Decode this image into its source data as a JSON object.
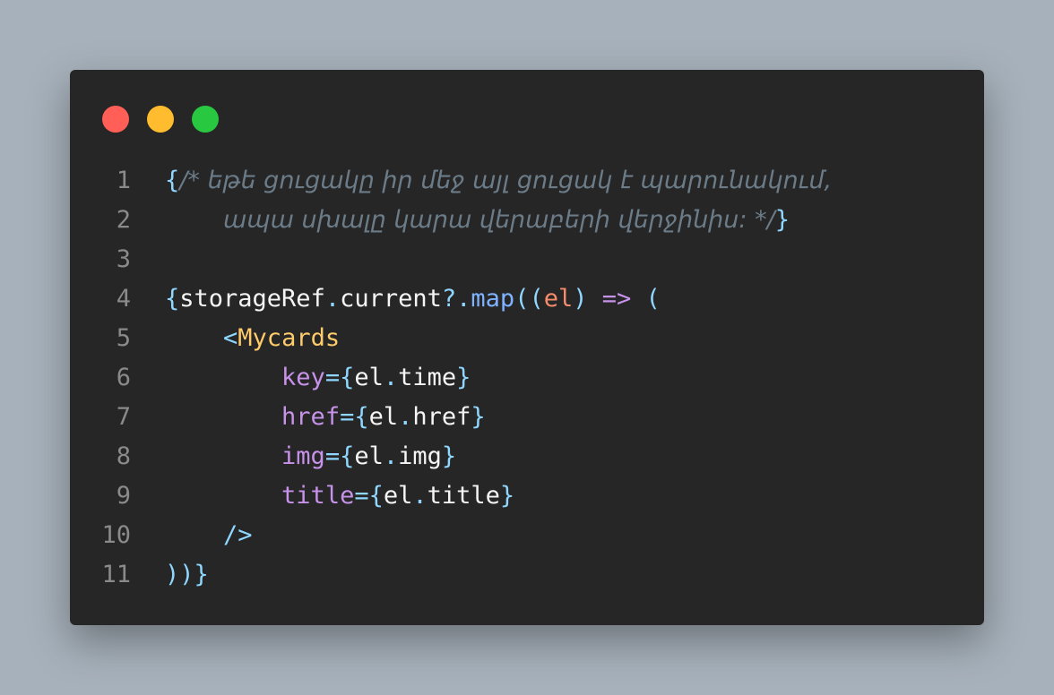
{
  "theme": {
    "background": "#a7b1bb",
    "window_bg": "#262626",
    "dot_red": "#ff5f57",
    "dot_yellow": "#febc2e",
    "dot_green": "#28c840",
    "line_number": "#8a8a8a",
    "plain": "#f5f5f5",
    "brace": "#8fd7ff",
    "comment": "#6b7c88",
    "function": "#7fb2ff",
    "param": "#f78c6c",
    "operator": "#c792ea",
    "component": "#ffcb6b",
    "attribute": "#c792ea"
  },
  "code": {
    "lines": [
      {
        "number": "1",
        "tokens": [
          {
            "text": "{",
            "kind": "brace"
          },
          {
            "text": "/* եթե ցուցակը իր մեջ այլ ցուցակ է պարունակում,",
            "kind": "comment"
          }
        ]
      },
      {
        "number": "2",
        "tokens": [
          {
            "text": "    ",
            "kind": "plain"
          },
          {
            "text": "ապա սխալը կարա վերաբերի վերջինիս: */",
            "kind": "comment"
          },
          {
            "text": "}",
            "kind": "brace"
          }
        ]
      },
      {
        "number": "3",
        "tokens": []
      },
      {
        "number": "4",
        "tokens": [
          {
            "text": "{",
            "kind": "brace"
          },
          {
            "text": "storageRef",
            "kind": "plain"
          },
          {
            "text": ".",
            "kind": "brace"
          },
          {
            "text": "current",
            "kind": "plain"
          },
          {
            "text": "?.",
            "kind": "brace"
          },
          {
            "text": "map",
            "kind": "function"
          },
          {
            "text": "((",
            "kind": "brace"
          },
          {
            "text": "el",
            "kind": "param"
          },
          {
            "text": ") ",
            "kind": "brace"
          },
          {
            "text": "=>",
            "kind": "operator"
          },
          {
            "text": " (",
            "kind": "brace"
          }
        ]
      },
      {
        "number": "5",
        "tokens": [
          {
            "text": "    ",
            "kind": "plain"
          },
          {
            "text": "<",
            "kind": "brace"
          },
          {
            "text": "Mycards",
            "kind": "component"
          }
        ]
      },
      {
        "number": "6",
        "tokens": [
          {
            "text": "        ",
            "kind": "plain"
          },
          {
            "text": "key",
            "kind": "attribute"
          },
          {
            "text": "={",
            "kind": "brace"
          },
          {
            "text": "el",
            "kind": "plain"
          },
          {
            "text": ".",
            "kind": "brace"
          },
          {
            "text": "time",
            "kind": "plain"
          },
          {
            "text": "}",
            "kind": "brace"
          }
        ]
      },
      {
        "number": "7",
        "tokens": [
          {
            "text": "        ",
            "kind": "plain"
          },
          {
            "text": "href",
            "kind": "attribute"
          },
          {
            "text": "={",
            "kind": "brace"
          },
          {
            "text": "el",
            "kind": "plain"
          },
          {
            "text": ".",
            "kind": "brace"
          },
          {
            "text": "href",
            "kind": "plain"
          },
          {
            "text": "}",
            "kind": "brace"
          }
        ]
      },
      {
        "number": "8",
        "tokens": [
          {
            "text": "        ",
            "kind": "plain"
          },
          {
            "text": "img",
            "kind": "attribute"
          },
          {
            "text": "={",
            "kind": "brace"
          },
          {
            "text": "el",
            "kind": "plain"
          },
          {
            "text": ".",
            "kind": "brace"
          },
          {
            "text": "img",
            "kind": "plain"
          },
          {
            "text": "}",
            "kind": "brace"
          }
        ]
      },
      {
        "number": "9",
        "tokens": [
          {
            "text": "        ",
            "kind": "plain"
          },
          {
            "text": "title",
            "kind": "attribute"
          },
          {
            "text": "={",
            "kind": "brace"
          },
          {
            "text": "el",
            "kind": "plain"
          },
          {
            "text": ".",
            "kind": "brace"
          },
          {
            "text": "title",
            "kind": "plain"
          },
          {
            "text": "}",
            "kind": "brace"
          }
        ]
      },
      {
        "number": "10",
        "tokens": [
          {
            "text": "    ",
            "kind": "plain"
          },
          {
            "text": "/>",
            "kind": "brace"
          }
        ]
      },
      {
        "number": "11",
        "tokens": [
          {
            "text": "))}",
            "kind": "brace"
          }
        ]
      }
    ]
  }
}
